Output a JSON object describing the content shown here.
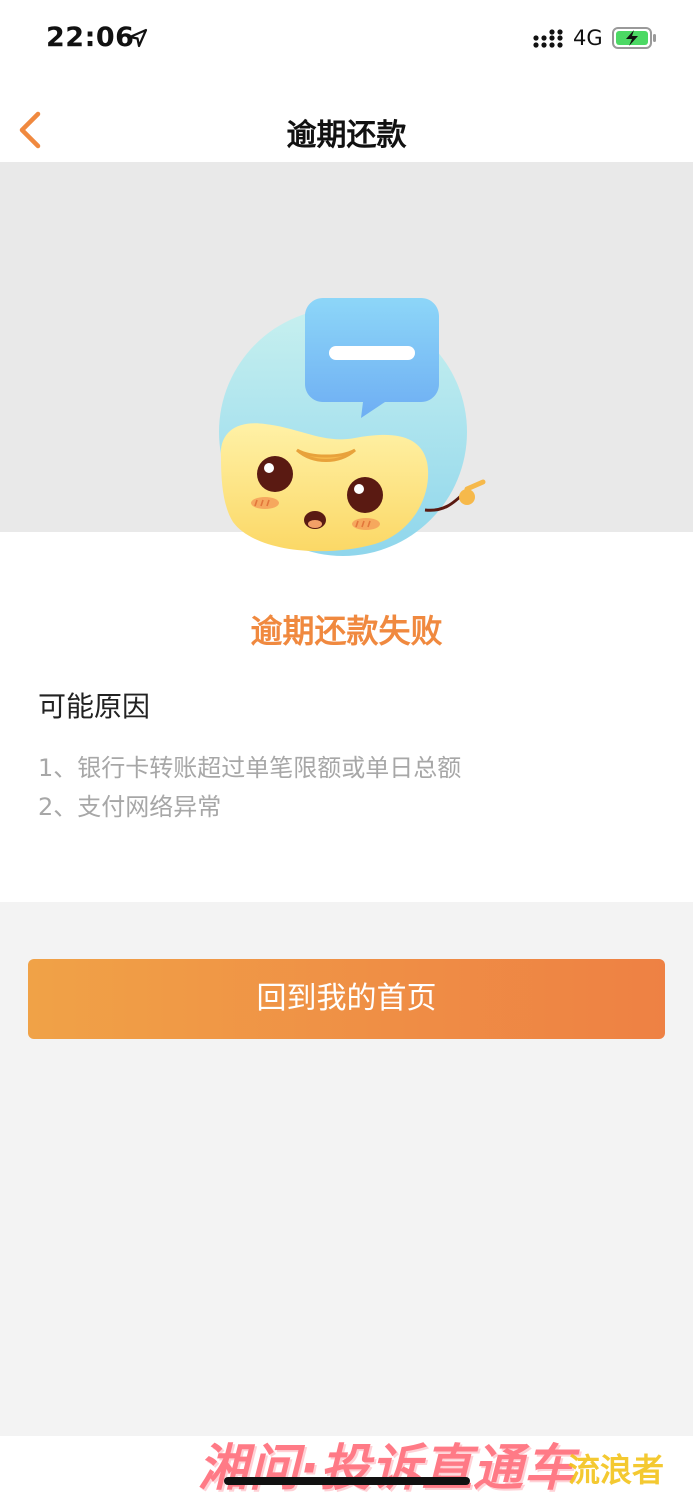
{
  "status_bar": {
    "time": "22:06",
    "network": "4G",
    "icons": [
      "location-arrow-icon",
      "signal-icon",
      "battery-charging-icon"
    ]
  },
  "nav": {
    "title": "逾期还款",
    "back_icon": "chevron-left-icon"
  },
  "result": {
    "title": "逾期还款失败",
    "reasons_heading": "可能原因",
    "reasons": [
      "1、银行卡转账超过单笔限额或单日总额",
      "2、支付网络异常"
    ]
  },
  "actions": {
    "home_label": "回到我的首页"
  },
  "watermark": {
    "logo_text": "湘问·投诉直通车",
    "sub_text": "流浪者"
  },
  "colors": {
    "accent": "#f0893f",
    "button_gradient_start": "#f0a247",
    "button_gradient_end": "#ee8144",
    "hero_bg": "#e9e9e9",
    "page_bg": "#f3f3f3"
  }
}
